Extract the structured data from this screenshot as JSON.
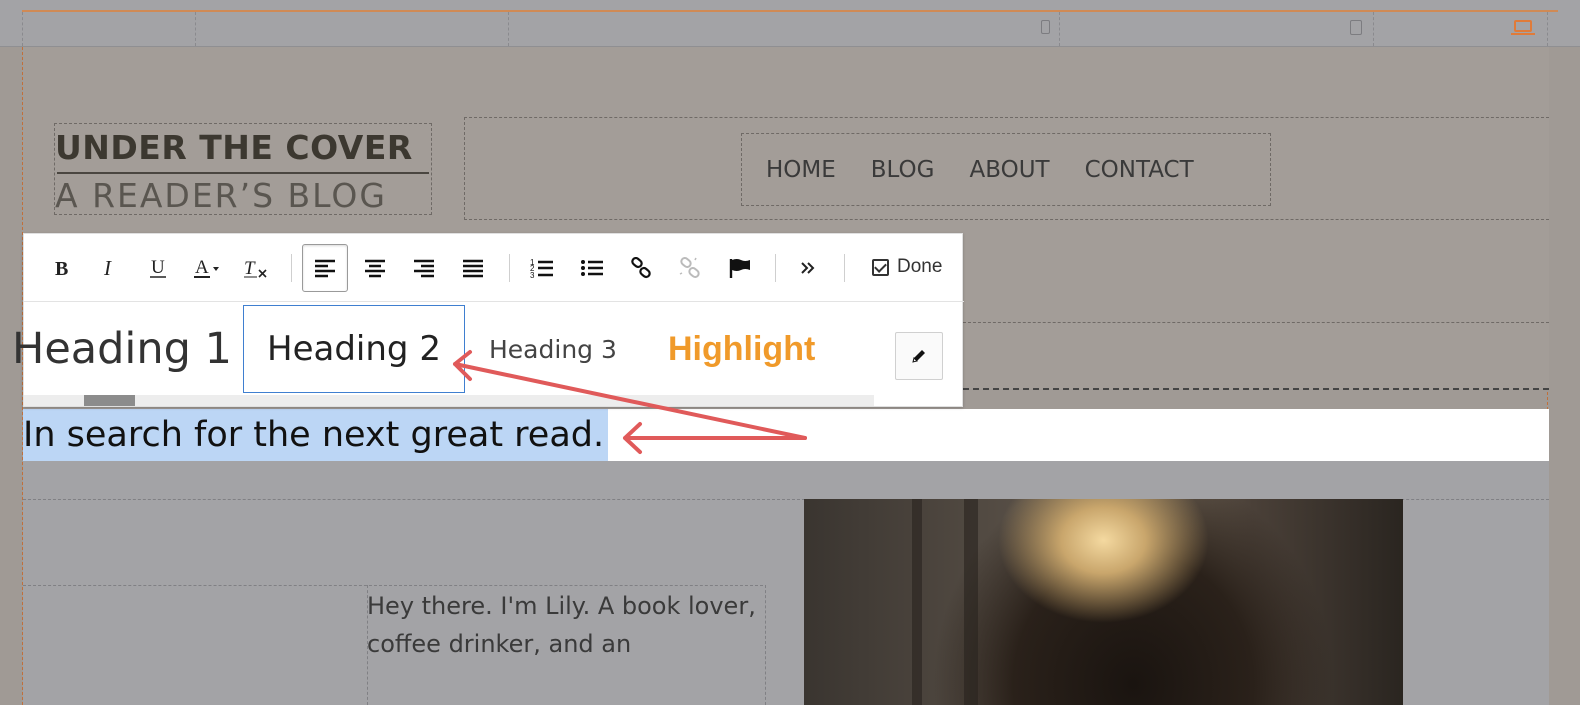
{
  "breakpoints": [
    {
      "icon": "phone-icon"
    },
    {
      "icon": "tablet-icon"
    },
    {
      "icon": "laptop-icon",
      "active_color": "#e07b39"
    }
  ],
  "site": {
    "logo_line1": "UNDER THE COVER",
    "logo_line2": "A READER’S BLOG",
    "nav": [
      "HOME",
      "BLOG",
      "ABOUT",
      "CONTACT"
    ]
  },
  "toolbar": {
    "buttons": [
      {
        "name": "bold-button",
        "icon": "bold-icon"
      },
      {
        "name": "italic-button",
        "icon": "italic-icon"
      },
      {
        "name": "underline-button",
        "icon": "underline-icon"
      },
      {
        "name": "text-color-button",
        "icon": "text-color-icon"
      },
      {
        "name": "clear-format-button",
        "icon": "clear-format-icon"
      },
      {
        "name": "align-left-button",
        "icon": "align-left-icon",
        "active": true
      },
      {
        "name": "align-center-button",
        "icon": "align-center-icon"
      },
      {
        "name": "align-right-button",
        "icon": "align-right-icon"
      },
      {
        "name": "justify-button",
        "icon": "justify-icon"
      },
      {
        "name": "ordered-list-button",
        "icon": "ordered-list-icon"
      },
      {
        "name": "unordered-list-button",
        "icon": "unordered-list-icon"
      },
      {
        "name": "link-button",
        "icon": "link-icon"
      },
      {
        "name": "unlink-button",
        "icon": "unlink-icon"
      },
      {
        "name": "anchor-button",
        "icon": "flag-icon"
      },
      {
        "name": "more-button",
        "icon": "double-chevron-icon"
      }
    ],
    "done_label": "Done",
    "styles": {
      "h1": "Heading 1",
      "h2": "Heading 2",
      "h3": "Heading 3",
      "highlight": "Highlight"
    },
    "selected_style": "Heading 2",
    "highlight_color": "#f09a2a"
  },
  "editor": {
    "selected_text": "In search for the next great read."
  },
  "bio": {
    "text": "Hey there. I'm Lily. A book lover, coffee drinker, and an"
  },
  "annotation": {
    "color": "#e05a5a"
  }
}
